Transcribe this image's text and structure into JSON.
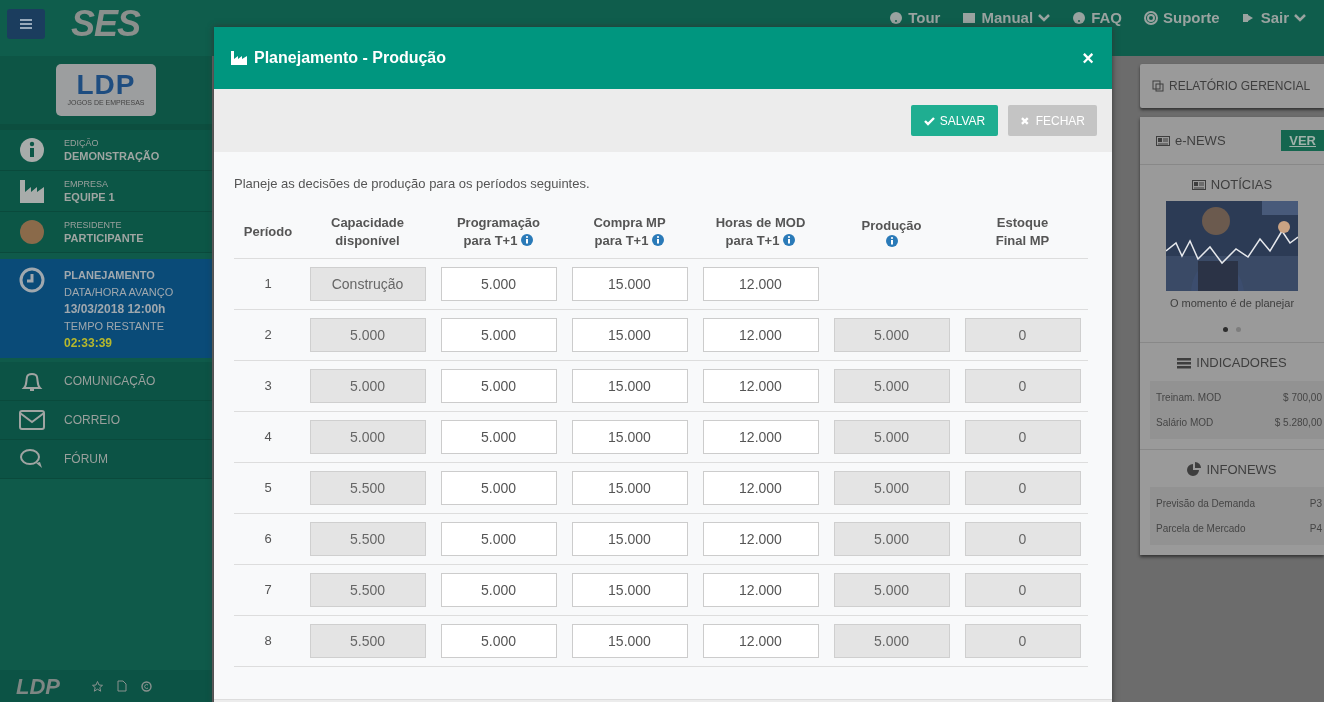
{
  "topbar": {
    "brand": "SES",
    "nav": [
      {
        "label": "Tour",
        "dropdown": false
      },
      {
        "label": "Manual",
        "dropdown": true
      },
      {
        "label": "FAQ",
        "dropdown": false
      },
      {
        "label": "Suporte",
        "dropdown": false
      },
      {
        "label": "Sair",
        "dropdown": true
      }
    ]
  },
  "sidebar": {
    "logo": {
      "mark": "LDP",
      "tagline": "JOGOS DE EMPRESAS"
    },
    "info": [
      {
        "label": "EDIÇÃO",
        "value": "DEMONSTRAÇÃO"
      },
      {
        "label": "EMPRESA",
        "value": "EQUIPE 1"
      },
      {
        "label": "PRESIDENTE",
        "value": "PARTICIPANTE"
      }
    ],
    "phase": {
      "title": "PLANEJAMENTO",
      "lines": [
        {
          "text": "DATA/HORA AVANÇO",
          "kind": "label"
        },
        {
          "text": "13/03/2018 12:00h",
          "kind": "value"
        },
        {
          "text": "TEMPO RESTANTE",
          "kind": "label"
        },
        {
          "text": "02:33:39",
          "kind": "timer"
        }
      ]
    },
    "menu": [
      {
        "label": "COMUNICAÇÃO"
      },
      {
        "label": "CORREIO"
      },
      {
        "label": "FÓRUM"
      }
    ],
    "footer_logo": "LDP"
  },
  "modal": {
    "title": "Planejamento - Produção",
    "close": "×",
    "buttons": [
      {
        "label": "SALVAR",
        "kind": "primary"
      },
      {
        "label": "FECHAR",
        "kind": "secondary"
      }
    ],
    "intro": "Planeje as decisões de produção para os períodos seguintes.",
    "columns": [
      {
        "lines": [
          "Período"
        ],
        "info": false
      },
      {
        "lines": [
          "Capacidade",
          "disponível"
        ],
        "info": false
      },
      {
        "lines": [
          "Programação",
          "para T+1"
        ],
        "info": true
      },
      {
        "lines": [
          "Compra MP",
          "para T+1"
        ],
        "info": true
      },
      {
        "lines": [
          "Horas de MOD",
          "para T+1"
        ],
        "info": true
      },
      {
        "lines": [
          "Produção"
        ],
        "info": true
      },
      {
        "lines": [
          "Estoque",
          "Final MP"
        ],
        "info": false
      }
    ],
    "rows": [
      {
        "cells": [
          {
            "kind": "period",
            "value": "1"
          },
          {
            "kind": "input",
            "value": "Construção",
            "readonly": true
          },
          {
            "kind": "input",
            "value": "5.000",
            "readonly": false
          },
          {
            "kind": "input",
            "value": "15.000",
            "readonly": false
          },
          {
            "kind": "input",
            "value": "12.000",
            "readonly": false
          }
        ]
      },
      {
        "cells": [
          {
            "kind": "period",
            "value": "2"
          },
          {
            "kind": "input",
            "value": "5.000",
            "readonly": true
          },
          {
            "kind": "input",
            "value": "5.000",
            "readonly": false
          },
          {
            "kind": "input",
            "value": "15.000",
            "readonly": false
          },
          {
            "kind": "input",
            "value": "12.000",
            "readonly": false
          },
          {
            "kind": "input",
            "value": "5.000",
            "readonly": true
          },
          {
            "kind": "input",
            "value": "0",
            "readonly": true
          }
        ]
      },
      {
        "cells": [
          {
            "kind": "period",
            "value": "3"
          },
          {
            "kind": "input",
            "value": "5.000",
            "readonly": true
          },
          {
            "kind": "input",
            "value": "5.000",
            "readonly": false
          },
          {
            "kind": "input",
            "value": "15.000",
            "readonly": false
          },
          {
            "kind": "input",
            "value": "12.000",
            "readonly": false
          },
          {
            "kind": "input",
            "value": "5.000",
            "readonly": true
          },
          {
            "kind": "input",
            "value": "0",
            "readonly": true
          }
        ]
      },
      {
        "cells": [
          {
            "kind": "period",
            "value": "4"
          },
          {
            "kind": "input",
            "value": "5.000",
            "readonly": true
          },
          {
            "kind": "input",
            "value": "5.000",
            "readonly": false
          },
          {
            "kind": "input",
            "value": "15.000",
            "readonly": false
          },
          {
            "kind": "input",
            "value": "12.000",
            "readonly": false
          },
          {
            "kind": "input",
            "value": "5.000",
            "readonly": true
          },
          {
            "kind": "input",
            "value": "0",
            "readonly": true
          }
        ]
      },
      {
        "cells": [
          {
            "kind": "period",
            "value": "5"
          },
          {
            "kind": "input",
            "value": "5.500",
            "readonly": true
          },
          {
            "kind": "input",
            "value": "5.000",
            "readonly": false
          },
          {
            "kind": "input",
            "value": "15.000",
            "readonly": false
          },
          {
            "kind": "input",
            "value": "12.000",
            "readonly": false
          },
          {
            "kind": "input",
            "value": "5.000",
            "readonly": true
          },
          {
            "kind": "input",
            "value": "0",
            "readonly": true
          }
        ]
      },
      {
        "cells": [
          {
            "kind": "period",
            "value": "6"
          },
          {
            "kind": "input",
            "value": "5.500",
            "readonly": true
          },
          {
            "kind": "input",
            "value": "5.000",
            "readonly": false
          },
          {
            "kind": "input",
            "value": "15.000",
            "readonly": false
          },
          {
            "kind": "input",
            "value": "12.000",
            "readonly": false
          },
          {
            "kind": "input",
            "value": "5.000",
            "readonly": true
          },
          {
            "kind": "input",
            "value": "0",
            "readonly": true
          }
        ]
      },
      {
        "cells": [
          {
            "kind": "period",
            "value": "7"
          },
          {
            "kind": "input",
            "value": "5.500",
            "readonly": true
          },
          {
            "kind": "input",
            "value": "5.000",
            "readonly": false
          },
          {
            "kind": "input",
            "value": "15.000",
            "readonly": false
          },
          {
            "kind": "input",
            "value": "12.000",
            "readonly": false
          },
          {
            "kind": "input",
            "value": "5.000",
            "readonly": true
          },
          {
            "kind": "input",
            "value": "0",
            "readonly": true
          }
        ]
      },
      {
        "cells": [
          {
            "kind": "period",
            "value": "8"
          },
          {
            "kind": "input",
            "value": "5.500",
            "readonly": true
          },
          {
            "kind": "input",
            "value": "5.000",
            "readonly": false
          },
          {
            "kind": "input",
            "value": "15.000",
            "readonly": false
          },
          {
            "kind": "input",
            "value": "12.000",
            "readonly": false
          },
          {
            "kind": "input",
            "value": "5.000",
            "readonly": true
          },
          {
            "kind": "input",
            "value": "0",
            "readonly": true
          }
        ]
      }
    ]
  },
  "right": {
    "report_button": "RELATÓRIO GERENCIAL",
    "enews": {
      "title": "e-NEWS",
      "badge": "VER",
      "news_title": "NOTÍCIAS",
      "caption": "O momento é de planejar",
      "dots": [
        {
          "selected": true
        },
        {
          "selected": false
        }
      ]
    },
    "indicators": {
      "title": "INDICADORES",
      "rows": [
        {
          "label": "Treinam. MOD",
          "value": "$ 700,00"
        },
        {
          "label": "Salário MOD",
          "value": "$ 5.280,00"
        }
      ]
    },
    "infonews": {
      "title": "INFONEWS",
      "rows": [
        {
          "label": "Previsão da Demanda",
          "value": "P3"
        },
        {
          "label": "Parcela de Mercado",
          "value": "P4"
        }
      ]
    }
  }
}
